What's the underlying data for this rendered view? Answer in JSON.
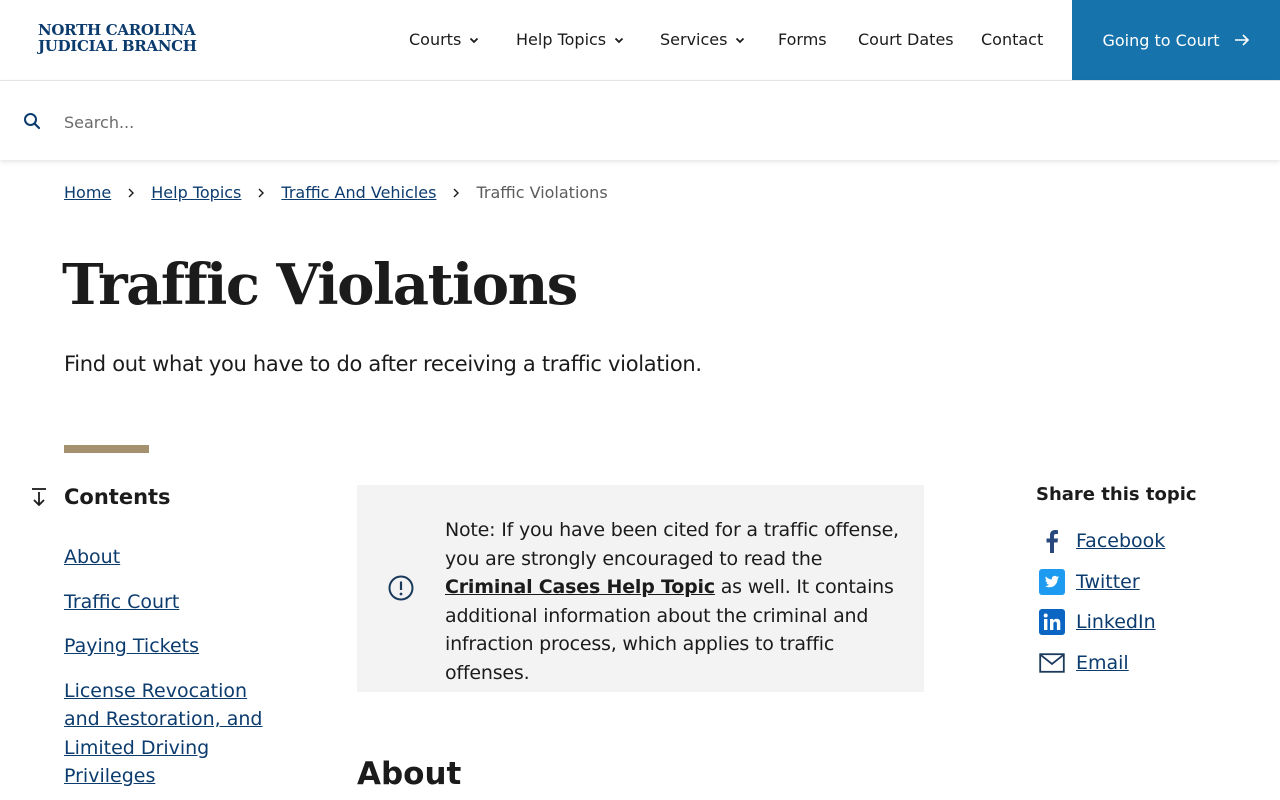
{
  "header": {
    "logo_line1": "NORTH CAROLINA",
    "logo_line2": "JUDICIAL BRANCH",
    "nav": [
      {
        "label": "Courts",
        "has_dropdown": true
      },
      {
        "label": "Help Topics",
        "has_dropdown": true
      },
      {
        "label": "Services",
        "has_dropdown": true
      },
      {
        "label": "Forms",
        "has_dropdown": false
      },
      {
        "label": "Court Dates",
        "has_dropdown": false
      },
      {
        "label": "Contact",
        "has_dropdown": false
      }
    ],
    "cta_label": "Going to Court",
    "cta_color": "#1773ac"
  },
  "search": {
    "placeholder": "Search...",
    "value": ""
  },
  "breadcrumb": {
    "items": [
      "Home",
      "Help Topics",
      "Traffic And Vehicles"
    ],
    "current": "Traffic Violations"
  },
  "page": {
    "title": "Traffic Violations",
    "subtitle": "Find out what you have to do after receiving a traffic violation."
  },
  "contents": {
    "heading": "Contents",
    "items": [
      "About",
      "Traffic Court",
      "Paying Tickets",
      "License Revocation and Restoration, and Limited Driving Privileges"
    ]
  },
  "note": {
    "text_before": "Note: If you have been cited for a traffic offense, you are strongly encouraged to read the ",
    "link_text": "Criminal Cases Help Topic",
    "text_after": " as well. It contains additional information about the criminal and infraction process, which applies to traffic offenses."
  },
  "sections": {
    "about_heading": "About"
  },
  "share": {
    "title": "Share this topic",
    "items": [
      {
        "label": "Facebook",
        "icon": "facebook-icon"
      },
      {
        "label": "Twitter",
        "icon": "twitter-icon"
      },
      {
        "label": "LinkedIn",
        "icon": "linkedin-icon"
      },
      {
        "label": "Email",
        "icon": "email-icon"
      }
    ]
  },
  "colors": {
    "brand_navy": "#0c3b6e",
    "link_blue": "#0c3b6e",
    "accent_gold": "#a39170",
    "note_bg": "#f3f3f3"
  }
}
